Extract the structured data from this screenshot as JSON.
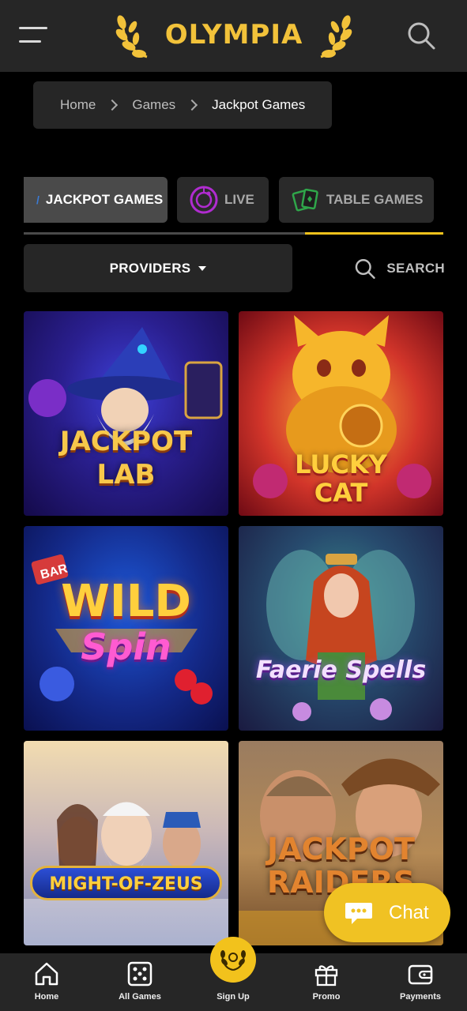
{
  "header": {
    "brand": "OLYMPIA",
    "menu_icon": "hamburger-menu-icon",
    "search_icon": "search-icon"
  },
  "breadcrumb": {
    "items": [
      "Home",
      "Games",
      "Jackpot Games"
    ]
  },
  "categories": {
    "tabs": [
      {
        "label": "JACKPOT GAMES",
        "icon": "jackpot-icon",
        "active": true
      },
      {
        "label": "LIVE",
        "icon": "roulette-icon",
        "active": false
      },
      {
        "label": "TABLE GAMES",
        "icon": "cards-icon",
        "active": false
      }
    ],
    "scroll_position": 0.67
  },
  "filters": {
    "providers_label": "PROVIDERS",
    "search_label": "SEARCH"
  },
  "games": [
    {
      "line1": "JACKPOT",
      "line2": "LAB"
    },
    {
      "line1": "LUCKY",
      "line2": "CAT"
    },
    {
      "line1": "WILD",
      "line2": "Spin"
    },
    {
      "line1": "Faerie Spells",
      "line2": ""
    },
    {
      "line1": "MIGHT-OF-ZEUS",
      "line2": ""
    },
    {
      "line1": "JACKPOT",
      "line2": "RAIDERS"
    }
  ],
  "chat": {
    "label": "Chat"
  },
  "bottom_nav": [
    {
      "label": "Home",
      "icon": "home-icon"
    },
    {
      "label": "All Games",
      "icon": "dice-icon"
    },
    {
      "label": "Sign Up",
      "icon": "laurel-icon"
    },
    {
      "label": "Promo",
      "icon": "gift-icon"
    },
    {
      "label": "Payments",
      "icon": "wallet-icon"
    }
  ],
  "colors": {
    "accent": "#f2c21c",
    "header_bg": "#262626",
    "background": "#000000"
  }
}
